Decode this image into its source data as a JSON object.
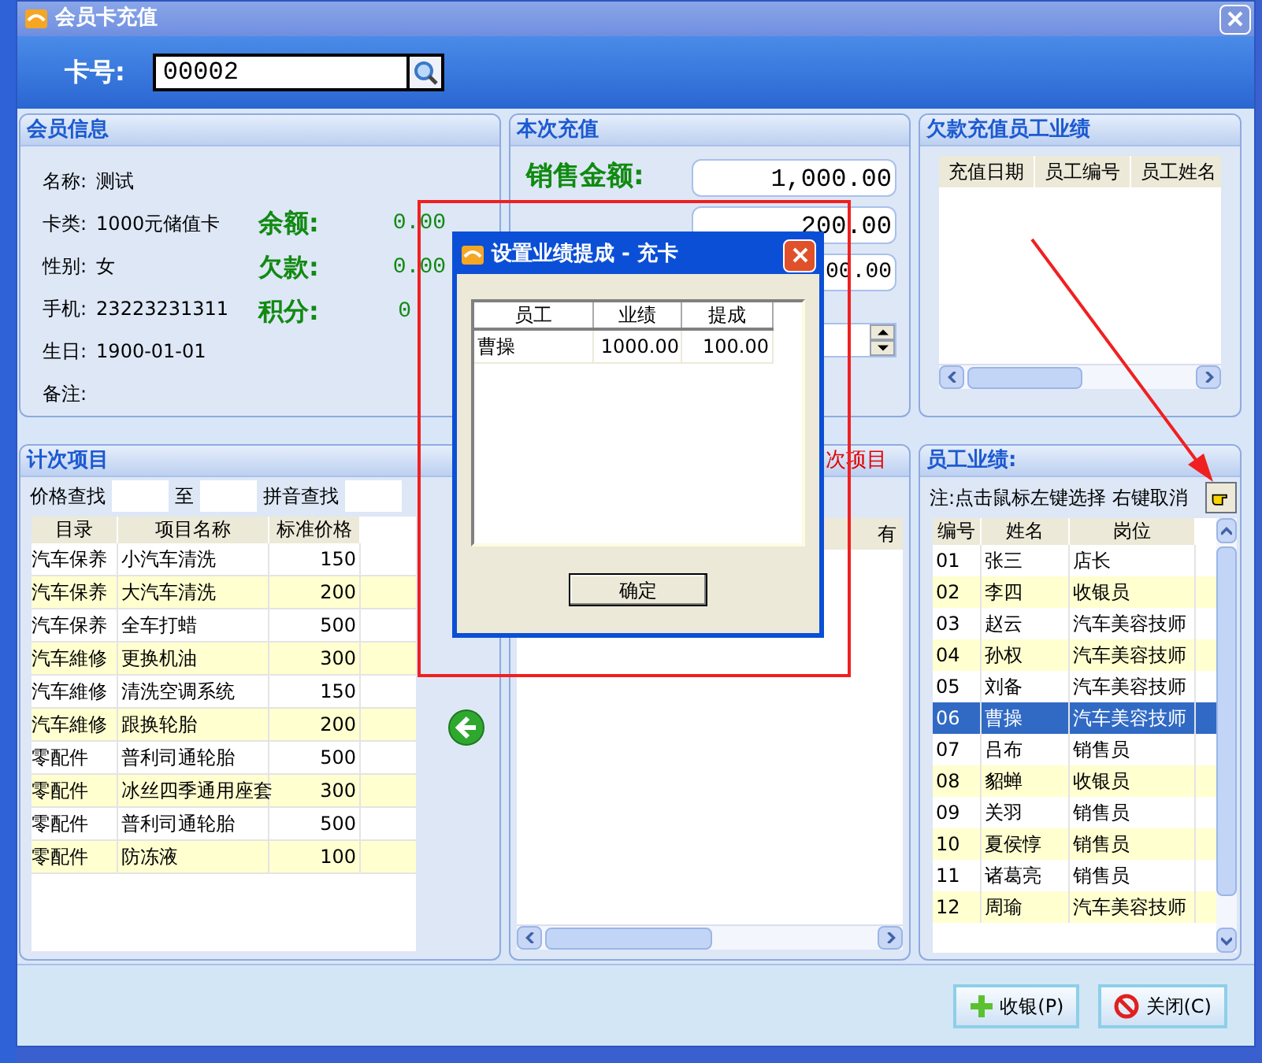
{
  "window": {
    "title": "会员卡充值"
  },
  "card": {
    "label": "卡号:",
    "value": "00002"
  },
  "member_info": {
    "title": "会员信息",
    "fields": [
      {
        "label": "名称:",
        "value": "测试"
      },
      {
        "label": "卡类:",
        "value": "1000元储值卡"
      },
      {
        "label": "性别:",
        "value": "女"
      },
      {
        "label": "手机:",
        "value": "23223231311"
      },
      {
        "label": "生日:",
        "value": "1900-01-01"
      },
      {
        "label": "备注:"
      }
    ],
    "balances": [
      {
        "label": "余额:",
        "value": "0.00"
      },
      {
        "label": "欠款:",
        "value": "0.00"
      },
      {
        "label": "积分:",
        "value": "0"
      }
    ]
  },
  "recharge": {
    "title": "本次充值",
    "rows": [
      {
        "label": "销售金额:",
        "value": "1,000.00"
      },
      {
        "value": "200.00"
      },
      {
        "value": "00.00"
      }
    ]
  },
  "debt_staff": {
    "title": "欠款充值员工业绩",
    "columns": [
      "充值日期",
      "员工编号",
      "员工姓名"
    ]
  },
  "count_items": {
    "title": "计次项目",
    "price_search": "价格查找",
    "to": "至",
    "pinyin_search": "拼音查找",
    "columns": [
      "目录",
      "项目名称",
      "标准价格"
    ],
    "rows": [
      [
        "汽车保养",
        "小汽车清洗",
        "150"
      ],
      [
        "汽车保养",
        "大汽车清洗",
        "200"
      ],
      [
        "汽车保养",
        "全车打蜡",
        "500"
      ],
      [
        "汽车維修",
        "更换机油",
        "300"
      ],
      [
        "汽车維修",
        "清洗空调系统",
        "150"
      ],
      [
        "汽车維修",
        "跟换轮胎",
        "200"
      ],
      [
        "零配件",
        "普利司通轮胎",
        "500"
      ],
      [
        "零配件",
        "冰丝四季通用座套",
        "300"
      ],
      [
        "零配件",
        "普利司通轮胎",
        "500"
      ],
      [
        "零配件",
        "防冻液",
        "100"
      ]
    ]
  },
  "chosen_items": {
    "title": "次项目",
    "columns": [
      "有"
    ]
  },
  "staff": {
    "title": "员工业绩:",
    "note": "注:点击鼠标左键选择 右键取消",
    "columns": [
      "编号",
      "姓名",
      "岗位"
    ],
    "rows": [
      {
        "cells": [
          "01",
          "张三",
          "店长"
        ],
        "selected": false
      },
      {
        "cells": [
          "02",
          "李四",
          "收银员"
        ],
        "selected": false
      },
      {
        "cells": [
          "03",
          "赵云",
          "汽车美容技师"
        ],
        "selected": false
      },
      {
        "cells": [
          "04",
          "孙权",
          "汽车美容技师"
        ],
        "selected": false
      },
      {
        "cells": [
          "05",
          "刘备",
          "汽车美容技师"
        ],
        "selected": false
      },
      {
        "cells": [
          "06",
          "曹操",
          "汽车美容技师"
        ],
        "selected": true
      },
      {
        "cells": [
          "07",
          "吕布",
          "销售员"
        ],
        "selected": false
      },
      {
        "cells": [
          "08",
          "貂蝉",
          "收银员"
        ],
        "selected": false
      },
      {
        "cells": [
          "09",
          "关羽",
          "销售员"
        ],
        "selected": false
      },
      {
        "cells": [
          "10",
          "夏侯惇",
          "销售员"
        ],
        "selected": false
      },
      {
        "cells": [
          "11",
          "诸葛亮",
          "销售员"
        ],
        "selected": false
      },
      {
        "cells": [
          "12",
          "周瑜",
          "汽车美容技师"
        ],
        "selected": false
      }
    ]
  },
  "dialog": {
    "title": "设置业绩提成 - 充卡",
    "columns": [
      "员工",
      "业绩",
      "提成"
    ],
    "rows": [
      [
        "曹操",
        "1000.00",
        "100.00"
      ]
    ],
    "ok": "确定"
  },
  "buttons": [
    {
      "label": "收银(P)",
      "kind": "checkout"
    },
    {
      "label": "关闭(C)",
      "kind": "close"
    }
  ]
}
